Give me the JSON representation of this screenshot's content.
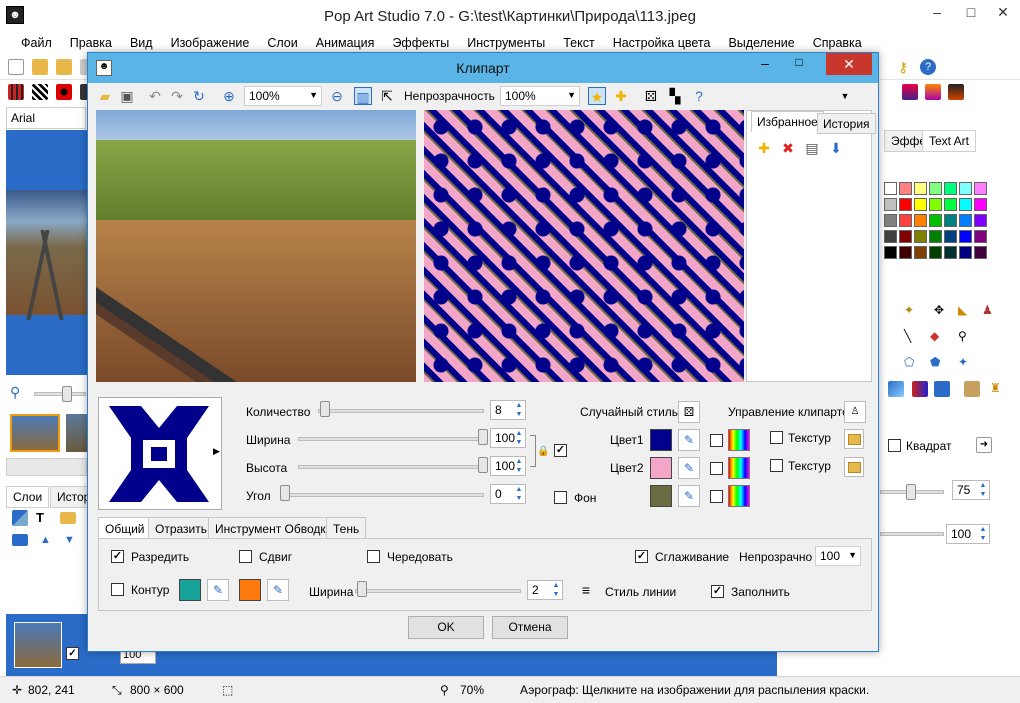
{
  "app": {
    "title": "Pop Art Studio 7.0 - G:\\test\\Картинки\\Природа\\113.jpeg",
    "icon": "app-logo-icon"
  },
  "window_controls": {
    "minimize": "–",
    "maximize": "□",
    "close": "✕"
  },
  "menu": [
    "Файл",
    "Правка",
    "Вид",
    "Изображение",
    "Слои",
    "Анимация",
    "Эффекты",
    "Инструменты",
    "Текст",
    "Настройка цвета",
    "Выделение",
    "Справка"
  ],
  "font_name": "Arial",
  "left_panel": {
    "tabs": [
      "Слои",
      "Истор"
    ],
    "layer_opacity": "100"
  },
  "right_panel": {
    "tabs": [
      "Эффекты",
      "Text Art"
    ],
    "shape_label": "Квадрат",
    "spin1": "75",
    "spin2": "100",
    "palette": [
      "#ffffff",
      "#ff8080",
      "#ffff80",
      "#80ff80",
      "#00ff80",
      "#80ffff",
      "#ff80ff",
      "#c0c0c0",
      "#ff0000",
      "#ffff00",
      "#80ff00",
      "#00ff40",
      "#00ffff",
      "#ff00ff",
      "#808080",
      "#ff4040",
      "#ff8000",
      "#00c000",
      "#008080",
      "#0080ff",
      "#8000ff",
      "#404040",
      "#800000",
      "#808000",
      "#008000",
      "#004080",
      "#0000ff",
      "#800080",
      "#000000",
      "#400000",
      "#804000",
      "#004000",
      "#003030",
      "#000080",
      "#400040"
    ]
  },
  "statusbar": {
    "coords": "802, 241",
    "size": "800 × 600",
    "zoom": "70%",
    "hint": "Аэрограф: Щелкните на изображении для распыления краски."
  },
  "dialog": {
    "title": "Клипарт",
    "toolbar": {
      "zoom": "100%",
      "opacity_label": "Непрозрачность",
      "opacity": "100%"
    },
    "panel_tabs": [
      "Избранное",
      "История"
    ],
    "settings": {
      "count_label": "Количество",
      "count": "8",
      "width_label": "Ширина",
      "width": "100",
      "height_label": "Высота",
      "height": "100",
      "angle_label": "Угол",
      "angle": "0",
      "random_style": "Случайный стиль",
      "manage_label": "Управление клипартом",
      "color1_label": "Цвет1",
      "color2_label": "Цвет2",
      "bg_label": "Фон",
      "texture_label_1": "Текстур",
      "texture_label_2": "Текстур",
      "color1": "#00008b",
      "color2": "#f4a6c8",
      "bg_color": "#6b6b42",
      "proportion_checked": true
    },
    "tabs": [
      "Общий",
      "Отразить",
      "Инструмент Обводка",
      "Тень"
    ],
    "general": {
      "spread_label": "Разредить",
      "spread_checked": true,
      "shift_label": "Сдвиг",
      "shift_checked": false,
      "alternate_label": "Чередовать",
      "alternate_checked": false,
      "smooth_label": "Сглаживание",
      "smooth_checked": true,
      "opacity_label": "Непрозрачно",
      "opacity": "100",
      "outline_label": "Контур",
      "outline_checked": false,
      "outline_color1": "#15a39a",
      "outline_color2": "#ff7a0d",
      "width_label": "Ширина",
      "width": "2",
      "line_style_label": "Стиль линии",
      "fill_label": "Заполнить",
      "fill_checked": true
    },
    "buttons": {
      "ok": "OK",
      "cancel": "Отмена"
    }
  }
}
